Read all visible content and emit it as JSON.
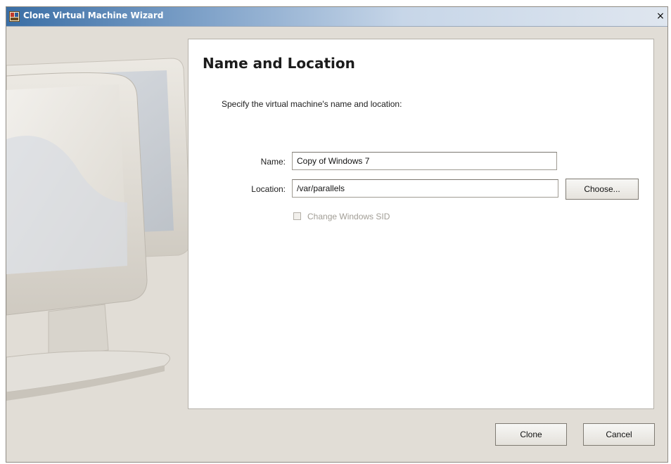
{
  "window": {
    "title": "Clone Virtual Machine Wizard",
    "close_glyph": "×"
  },
  "step": {
    "heading": "Name and Location",
    "instruction": "Specify the virtual machine's name and location:"
  },
  "form": {
    "name_label": "Name:",
    "name_value": "Copy of Windows 7",
    "location_label": "Location:",
    "location_value": "/var/parallels",
    "choose_label": "Choose...",
    "sid_label": "Change Windows SID",
    "sid_checked": false,
    "sid_enabled": false
  },
  "footer": {
    "clone_label": "Clone",
    "cancel_label": "Cancel"
  },
  "icons": {
    "app": "wizard-app-icon",
    "close": "close-icon"
  },
  "colors": {
    "titlebar_start": "#3a6ea5",
    "dialog_background": "#e1ddd6",
    "panel_background": "#ffffff"
  }
}
